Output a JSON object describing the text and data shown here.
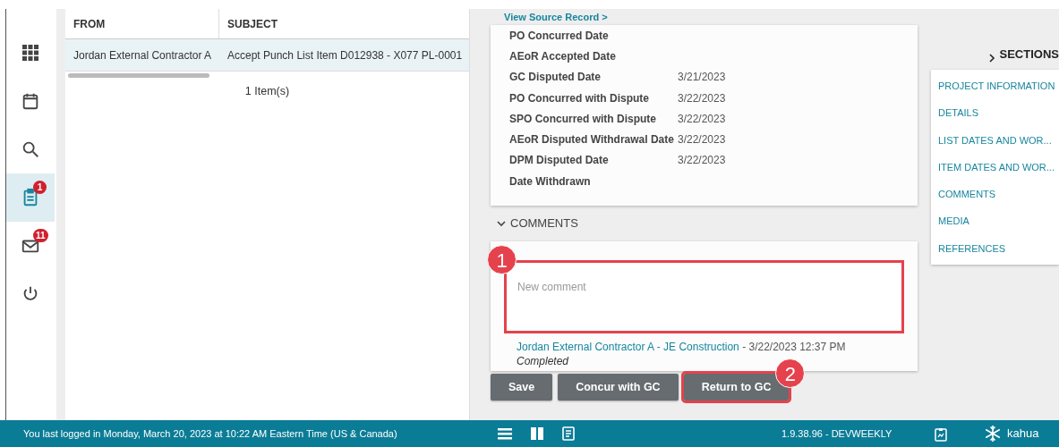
{
  "sidebar": {
    "items": [
      {
        "kind": "grid",
        "selected": false
      },
      {
        "kind": "calendar",
        "selected": false
      },
      {
        "kind": "search",
        "selected": false
      },
      {
        "kind": "clipboard",
        "selected": true,
        "badge": "1"
      },
      {
        "kind": "mail",
        "selected": false,
        "badge": "11"
      },
      {
        "kind": "power",
        "selected": false
      }
    ]
  },
  "inbox": {
    "columns": [
      "FROM",
      "SUBJECT"
    ],
    "rows": [
      {
        "selected": true,
        "cells": [
          "Jordan External Contractor A",
          "Accept Punch List Item D012938 - X077 PL-0001"
        ]
      }
    ],
    "footer": "1 Item(s)"
  },
  "record": {
    "link": "View Source Record >",
    "dates": [
      {
        "label": "PO Concurred Date"
      },
      {
        "label": "AEoR Accepted Date"
      },
      {
        "label": "GC Disputed Date",
        "value": "3/21/2023"
      },
      {
        "label": "PO Concurred with Dispute",
        "value": "3/22/2023"
      },
      {
        "label": "SPO Concurred with Dispute",
        "value": "3/22/2023"
      },
      {
        "label": "AEoR Disputed Withdrawal Date",
        "value": "3/22/2023"
      },
      {
        "label": "DPM Disputed Date",
        "value": "3/22/2023"
      },
      {
        "label": "Date Withdrawn"
      }
    ],
    "comments_section": {
      "heading": "COMMENTS",
      "expanded": true,
      "new_comment": {
        "placeholder": "New comment",
        "highlighted": true,
        "annotation": "1"
      },
      "comments": [
        {
          "author": "Jordan External Contractor A - JE Construction",
          "time": "- 3/22/2023 12:37 PM",
          "text": "Completed"
        }
      ]
    }
  },
  "buttons": [
    {
      "label": "Save",
      "highlighted": false
    },
    {
      "label": "Concur with GC",
      "highlighted": false
    },
    {
      "label": "Return to GC",
      "highlighted": true,
      "annotation": "2"
    }
  ],
  "sections": {
    "heading": "SECTIONS",
    "items": [
      "PROJECT INFORMATION",
      "DETAILS",
      "LIST DATES AND WOR...",
      "ITEM DATES AND WOR...",
      "COMMENTS",
      "MEDIA",
      "REFERENCES"
    ]
  },
  "status_bar": {
    "login_text": "You last logged in Monday, March 20, 2023 at 10:22 AM Eastern Time (US & Canada)",
    "version": "1.9.38.96 - DEVWEEKLY",
    "brand": "kahua"
  }
}
